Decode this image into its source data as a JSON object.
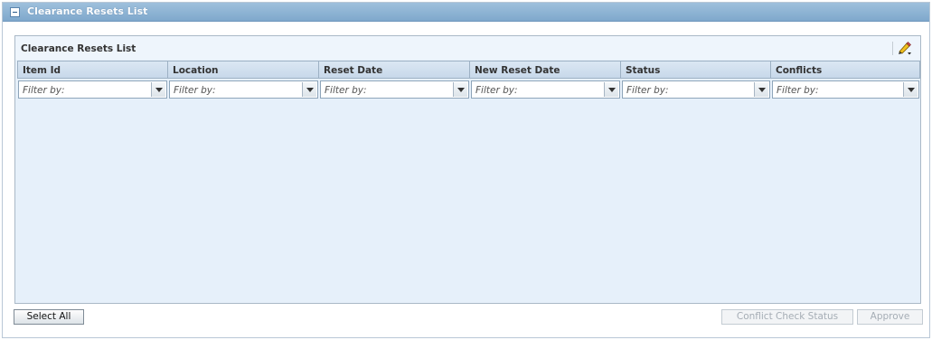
{
  "panel": {
    "title": "Clearance Resets List"
  },
  "grid": {
    "title": "Clearance Resets List",
    "columns": [
      {
        "label": "Item Id",
        "filter_placeholder": "Filter by:"
      },
      {
        "label": "Location",
        "filter_placeholder": "Filter by:"
      },
      {
        "label": "Reset Date",
        "filter_placeholder": "Filter by:"
      },
      {
        "label": "New Reset Date",
        "filter_placeholder": "Filter by:"
      },
      {
        "label": "Status",
        "filter_placeholder": "Filter by:"
      },
      {
        "label": "Conflicts",
        "filter_placeholder": "Filter by:"
      }
    ],
    "rows": []
  },
  "buttons": {
    "select_all": "Select All",
    "conflict_check_status": "Conflict Check Status",
    "approve": "Approve"
  },
  "icons": {
    "collapse": "collapse-icon",
    "edit": "pencil-edit-icon"
  },
  "colors": {
    "header_accent": "#8fb4d6",
    "grid_background": "#e6f0fa",
    "disabled_text": "#a5adb5"
  }
}
